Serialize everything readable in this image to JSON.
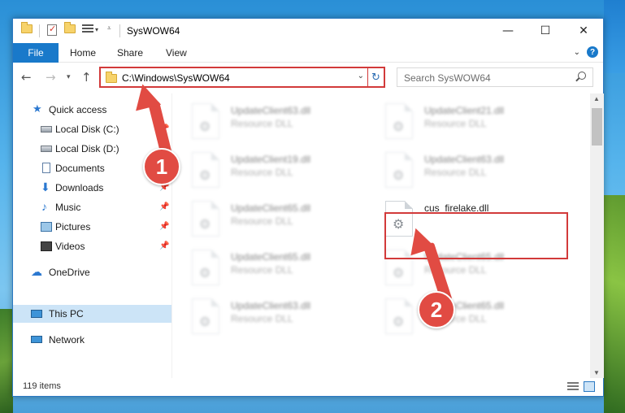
{
  "window": {
    "title": "SysWOW64",
    "minimize": "—",
    "maximize": "☐",
    "close": "✕"
  },
  "ribbon": {
    "file": "File",
    "tabs": [
      "Home",
      "Share",
      "View"
    ]
  },
  "address": {
    "path": "C:\\Windows\\SysWOW64",
    "search_placeholder": "Search SysWOW64"
  },
  "nav": {
    "items": [
      {
        "label": "Quick access",
        "icon": "quick-access-icon",
        "pinned": false
      },
      {
        "label": "Local Disk (C:)",
        "icon": "drive-icon",
        "pinned": true
      },
      {
        "label": "Local Disk (D:)",
        "icon": "drive-icon",
        "pinned": true
      },
      {
        "label": "Documents",
        "icon": "documents-icon",
        "pinned": true
      },
      {
        "label": "Downloads",
        "icon": "downloads-icon",
        "pinned": true
      },
      {
        "label": "Music",
        "icon": "music-icon",
        "pinned": true
      },
      {
        "label": "Pictures",
        "icon": "pictures-icon",
        "pinned": true
      },
      {
        "label": "Videos",
        "icon": "videos-icon",
        "pinned": true
      },
      {
        "label": "OneDrive",
        "icon": "onedrive-icon",
        "pinned": false
      },
      {
        "label": "This PC",
        "icon": "this-pc-icon",
        "pinned": false,
        "selected": true
      },
      {
        "label": "Network",
        "icon": "network-icon",
        "pinned": false
      }
    ]
  },
  "files": [
    {
      "name": "UpdateClient63.dll",
      "type": "Resource DLL",
      "blurred": true
    },
    {
      "name": "UpdateClient21.dll",
      "type": "Resource DLL",
      "blurred": true
    },
    {
      "name": "UpdateClient19.dll",
      "type": "Resource DLL",
      "blurred": true
    },
    {
      "name": "UpdateClient63.dll",
      "type": "Resource DLL",
      "blurred": true
    },
    {
      "name": "UpdateClient65.dll",
      "type": "Resource DLL",
      "blurred": true
    },
    {
      "name": "cus_firelake.dll",
      "type": "",
      "blurred": false
    },
    {
      "name": "UpdateClient65.dll",
      "type": "Resource DLL",
      "blurred": true
    },
    {
      "name": "UpdateClient65.dll",
      "type": "Resource DLL",
      "blurred": true
    },
    {
      "name": "UpdateClient63.dll",
      "type": "Resource DLL",
      "blurred": true
    },
    {
      "name": "UpdateClient65.dll",
      "type": "Resource DLL",
      "blurred": true
    }
  ],
  "status": {
    "item_count": "119 items"
  },
  "annotations": {
    "step1": "1",
    "step2": "2",
    "color": "#e14b43"
  }
}
